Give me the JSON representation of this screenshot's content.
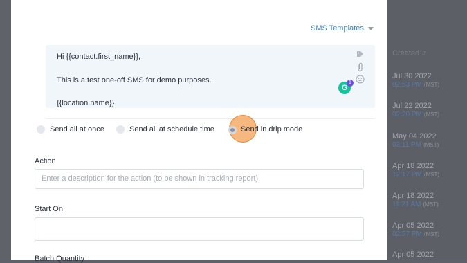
{
  "background_table": {
    "column_header": "Created",
    "rows": [
      {
        "date": "Jul 30 2022",
        "time": "02:53 PM",
        "tz": "(MST)"
      },
      {
        "date": "Jul 22 2022",
        "time": "02:20 PM",
        "tz": "(MST)"
      },
      {
        "date": "May 04 2022",
        "time": "03:11 PM",
        "tz": "(MST)"
      },
      {
        "date": "Apr 18 2022",
        "time": "12:17 PM",
        "tz": "(MST)"
      },
      {
        "date": "Apr 18 2022",
        "time": "11:21 AM",
        "tz": "(MST)"
      },
      {
        "date": "Apr 05 2022",
        "time": "02:57 PM",
        "tz": "(MST)"
      },
      {
        "date": "Apr 05 2022",
        "time": "",
        "tz": ""
      }
    ]
  },
  "modal": {
    "sms_templates_label": "SMS Templates",
    "message_lines": [
      "Hi  {{contact.first_name}},",
      "This is a test one-off SMS for demo purposes.",
      "{{location.name}}"
    ],
    "grammarly_letter": "G",
    "grammarly_badge": "1",
    "send_options": [
      "Send all at once",
      "Send all at schedule time",
      "Send in drip mode"
    ],
    "selected_option": "Send in drip mode",
    "action_label": "Action",
    "action_placeholder": "Enter a description for the action (to be shown in tracking report)",
    "start_on_label": "Start On",
    "batch_quantity_label": "Batch Quantity"
  }
}
